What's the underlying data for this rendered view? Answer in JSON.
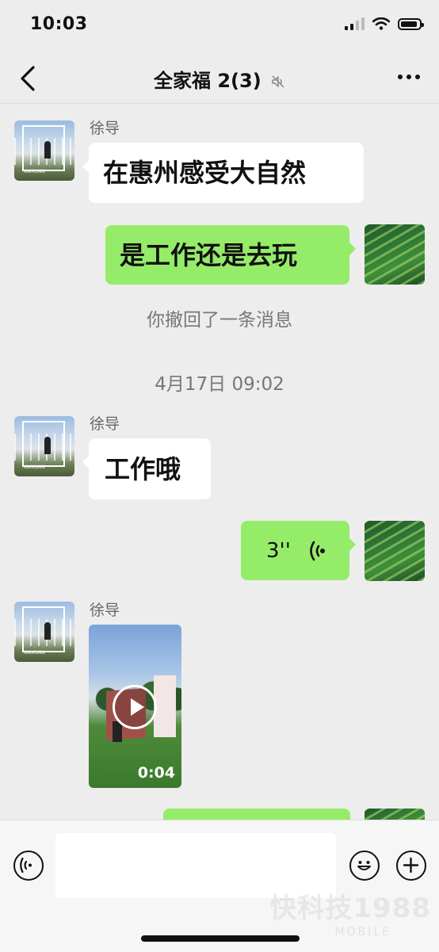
{
  "status_bar": {
    "time": "10:03"
  },
  "header": {
    "title": "全家福 2(3)"
  },
  "messages": {
    "m1": {
      "sender": "徐导",
      "text": "在惠州感受大自然"
    },
    "m2": {
      "text": "是工作还是去玩"
    },
    "recall_notice": "你撤回了一条消息",
    "timestamp": "4月17日 09:02",
    "m3": {
      "sender": "徐导",
      "text": "工作哦"
    },
    "m4": {
      "voice_duration": "3''"
    },
    "m5": {
      "sender": "徐导",
      "video_duration": "0:04"
    }
  },
  "input_bar": {
    "placeholder": ""
  },
  "watermark": {
    "main": "快科技1988",
    "sub": "MOBILE"
  },
  "icons": [
    "back-icon",
    "muted-icon",
    "more-icon",
    "voice-input-icon",
    "emoji-icon",
    "add-icon",
    "play-icon",
    "voice-wave-icon"
  ]
}
